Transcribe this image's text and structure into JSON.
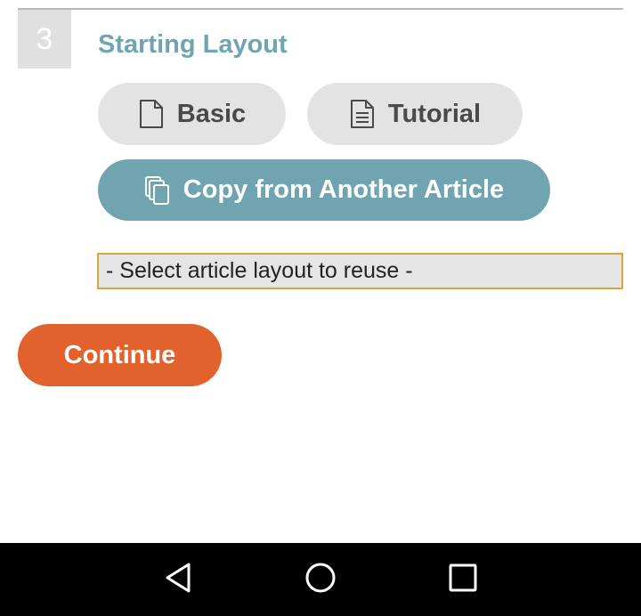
{
  "step": {
    "number": "3",
    "title": "Starting Layout"
  },
  "layout_options": {
    "basic": {
      "label": "Basic",
      "icon": "document-icon"
    },
    "tutorial": {
      "label": "Tutorial",
      "icon": "document-lines-icon"
    },
    "copy": {
      "label": "Copy from Another Article",
      "icon": "copy-documents-icon"
    }
  },
  "layout_select": {
    "selected": "- Select article layout to reuse -"
  },
  "continue_label": "Continue",
  "navigation_bar": {
    "back_icon": "triangle-back-icon",
    "home_icon": "circle-home-icon",
    "recents_icon": "square-recents-icon"
  },
  "colors": {
    "accent_teal": "#6fa4b0",
    "continue_orange": "#e2622e",
    "select_border": "#d6a83a",
    "pill_gray": "#e3e3e3"
  }
}
